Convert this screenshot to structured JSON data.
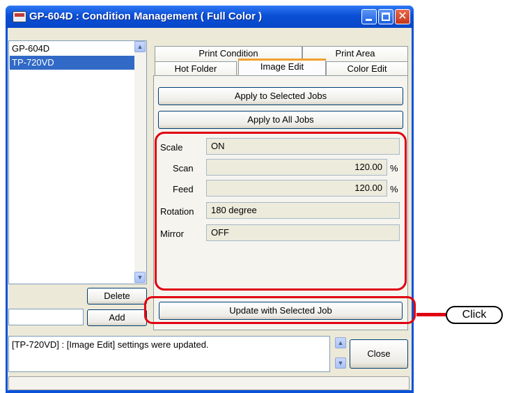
{
  "window": {
    "title": "GP-604D : Condition Management ( Full Color )"
  },
  "device_list": {
    "items": [
      "GP-604D",
      "TP-720VD"
    ],
    "selected_index": 1
  },
  "left_buttons": {
    "delete_label": "Delete",
    "add_label": "Add",
    "add_input_value": ""
  },
  "tabs": {
    "row_top": [
      "Print Condition",
      "Print Area"
    ],
    "row_bottom": [
      "Hot Folder",
      "Image Edit",
      "Color Edit"
    ],
    "active": "Image Edit"
  },
  "actions": {
    "apply_selected": "Apply to Selected Jobs",
    "apply_all": "Apply to All Jobs",
    "update_selected": "Update with Selected Job"
  },
  "fields": {
    "scale_label": "Scale",
    "scale_value": "ON",
    "scan_label": "Scan",
    "scan_value": "120.00",
    "scan_unit": "%",
    "feed_label": "Feed",
    "feed_value": "120.00",
    "feed_unit": "%",
    "rotation_label": "Rotation",
    "rotation_value": "180 degree",
    "mirror_label": "Mirror",
    "mirror_value": "OFF"
  },
  "status": {
    "message": "[TP-720VD] : [Image Edit] settings were updated.",
    "close_label": "Close"
  },
  "annotation": {
    "callout_label": "Click",
    "highlight_color": "#e0000f"
  }
}
